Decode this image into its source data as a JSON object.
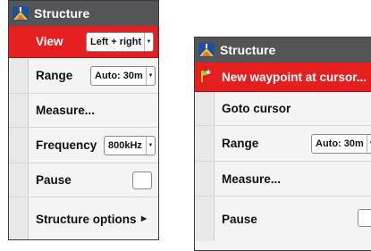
{
  "menu1": {
    "title": "Structure",
    "view": {
      "label": "View",
      "value": "Left + right"
    },
    "range": {
      "label": "Range",
      "value": "Auto: 30m"
    },
    "measure": {
      "label": "Measure..."
    },
    "frequency": {
      "label": "Frequency",
      "value": "800kHz"
    },
    "pause": {
      "label": "Pause",
      "checked": false
    },
    "structure_options": {
      "label": "Structure options"
    }
  },
  "menu2": {
    "title": "Structure",
    "new_waypoint": {
      "label": "New waypoint at cursor..."
    },
    "goto_cursor": {
      "label": "Goto cursor"
    },
    "range": {
      "label": "Range",
      "value": "Auto: 30m"
    },
    "measure": {
      "label": "Measure..."
    },
    "pause": {
      "label": "Pause",
      "checked": false
    }
  },
  "colors": {
    "selected_row": "#e51f1f",
    "titlebar": "#555557",
    "row_bg": "#f4f4f4"
  },
  "icons": {
    "title": "structure-scan-icon",
    "waypoint": "waypoint-flag-icon",
    "dropdown": "dropdown-arrow-icon",
    "submenu": "submenu-arrow-icon"
  }
}
